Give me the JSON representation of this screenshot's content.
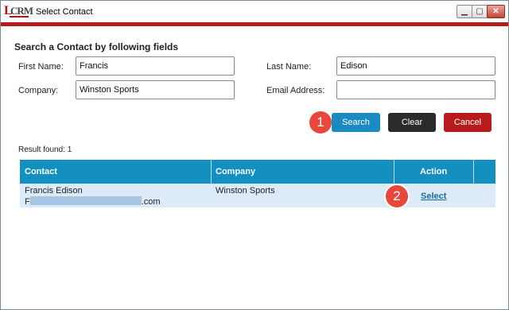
{
  "window": {
    "title": "Select Contact",
    "logo_text": "CRM",
    "buttons": {
      "minimize": "▁",
      "maximize": "▢",
      "close": "✕"
    }
  },
  "form": {
    "heading": "Search a Contact by following fields",
    "first_name": {
      "label": "First Name:",
      "value": "Francis"
    },
    "last_name": {
      "label": "Last Name:",
      "value": "Edison"
    },
    "company": {
      "label": "Company:",
      "value": "Winston Sports"
    },
    "email": {
      "label": "Email Address:",
      "value": ""
    }
  },
  "actions": {
    "search": "Search",
    "clear": "Clear",
    "cancel": "Cancel"
  },
  "callouts": {
    "one": "1",
    "two": "2"
  },
  "results": {
    "count_text": "Result found: 1",
    "columns": {
      "contact": "Contact",
      "company": "Company",
      "action": "Action"
    },
    "rows": [
      {
        "contact_name": "Francis Edison",
        "email_prefix": "F",
        "email_suffix": ".com",
        "company": "Winston Sports",
        "action": "Select"
      }
    ]
  },
  "colors": {
    "accent_red": "#b71c1c",
    "header_blue": "#1390c0",
    "row_blue": "#dcebf7",
    "callout_red": "#e8473c"
  }
}
